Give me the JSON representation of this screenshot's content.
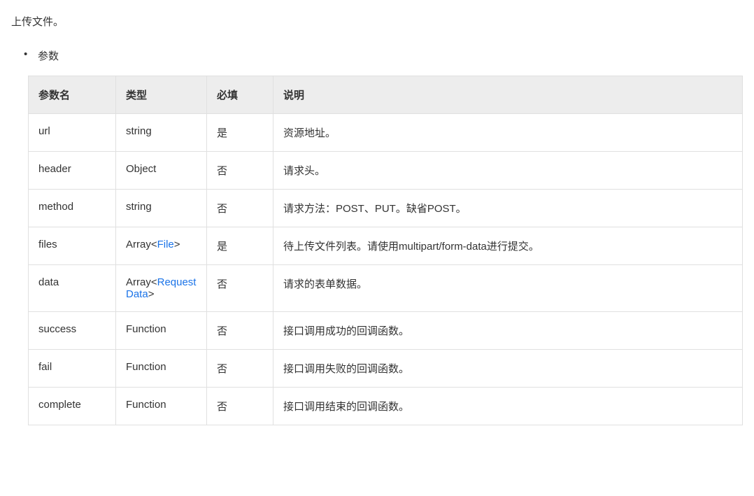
{
  "description": "上传文件。",
  "section_label": "参数",
  "headers": {
    "name": "参数名",
    "type": "类型",
    "required": "必填",
    "desc": "说明"
  },
  "rows": [
    {
      "name": "url",
      "type_prefix": "string",
      "type_link": "",
      "type_suffix": "",
      "required": "是",
      "desc": "资源地址。"
    },
    {
      "name": "header",
      "type_prefix": "Object",
      "type_link": "",
      "type_suffix": "",
      "required": "否",
      "desc": "请求头。"
    },
    {
      "name": "method",
      "type_prefix": "string",
      "type_link": "",
      "type_suffix": "",
      "required": "否",
      "desc": "请求方法：POST、PUT。缺省POST。"
    },
    {
      "name": "files",
      "type_prefix": "Array<",
      "type_link": "File",
      "type_suffix": ">",
      "required": "是",
      "desc": "待上传文件列表。请使用multipart/form-data进行提交。"
    },
    {
      "name": "data",
      "type_prefix": "Array<",
      "type_link": "RequestData",
      "type_suffix": ">",
      "required": "否",
      "desc": "请求的表单数据。"
    },
    {
      "name": "success",
      "type_prefix": "Function",
      "type_link": "",
      "type_suffix": "",
      "required": "否",
      "desc": "接口调用成功的回调函数。"
    },
    {
      "name": "fail",
      "type_prefix": "Function",
      "type_link": "",
      "type_suffix": "",
      "required": "否",
      "desc": "接口调用失败的回调函数。"
    },
    {
      "name": "complete",
      "type_prefix": "Function",
      "type_link": "",
      "type_suffix": "",
      "required": "否",
      "desc": "接口调用结束的回调函数。"
    }
  ]
}
